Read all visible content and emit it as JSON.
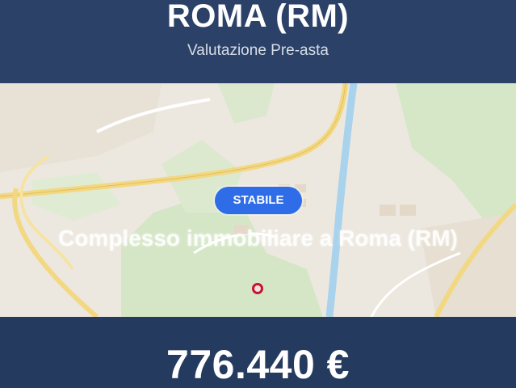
{
  "header": {
    "city": "ROMA (RM)",
    "subtitle": "Valutazione Pre-asta"
  },
  "badge": {
    "label": "STABILE",
    "color": "#2f6de8"
  },
  "overlay_title": "Complesso immobiliare a Roma (RM)",
  "map": {
    "marker_icon": "map-pin-icon",
    "marker_color": "#c3162b"
  },
  "footer": {
    "price": "776.440 €"
  }
}
